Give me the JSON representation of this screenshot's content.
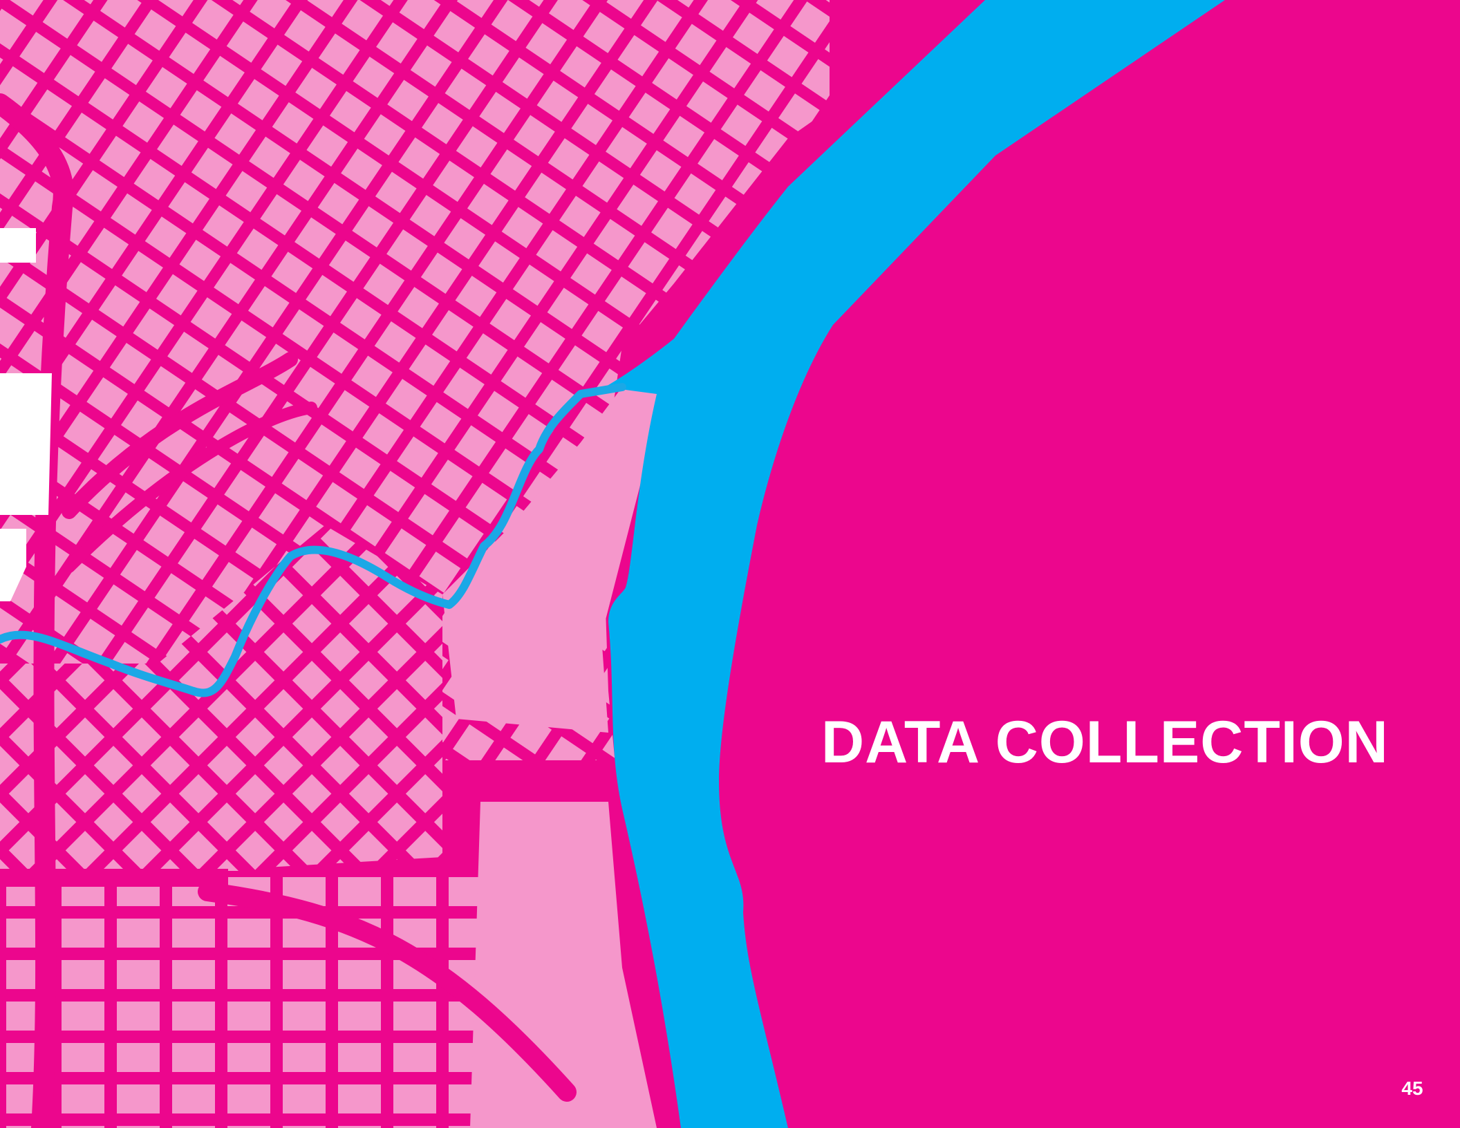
{
  "page": {
    "title": "DATA COLLECTION",
    "page_number": "45"
  },
  "colors": {
    "background": "#EC068D",
    "street": "#EC068D",
    "block": "#F597CB",
    "river": "#00AEEF",
    "trail": "#1BA8E6",
    "text": "#FFFFFF",
    "void": "#FFFFFF"
  },
  "map": {
    "image_type": "stylized-city-street-map",
    "features": [
      "city-blocks",
      "street-grid",
      "river",
      "creek-trail"
    ]
  }
}
